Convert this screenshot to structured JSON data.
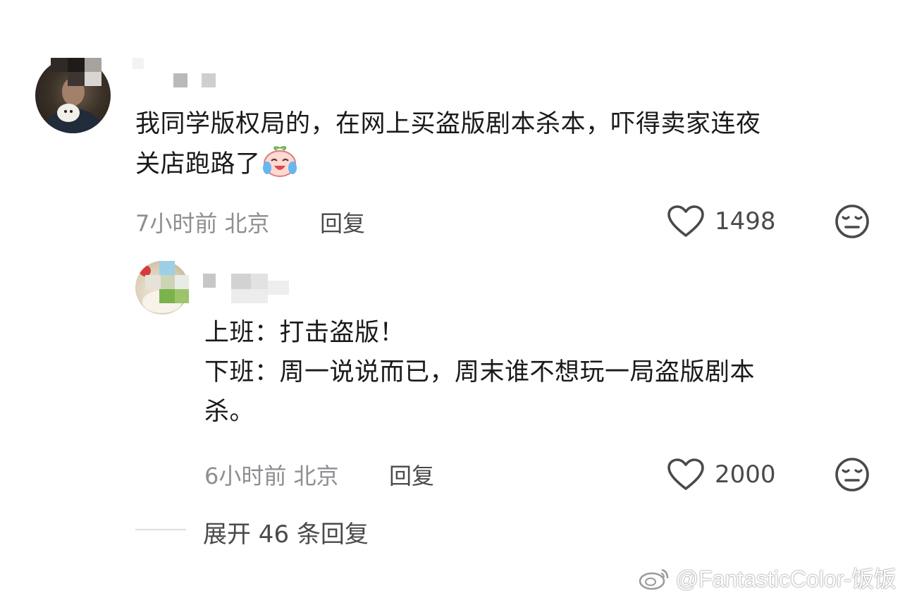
{
  "comments": [
    {
      "text_line1": "我同学版权局的，在网上买盗版剧本杀本，吓得卖家连夜",
      "text_line2": "关店跑路了",
      "emoji": "crying-laughing-emoji",
      "time": "7小时前",
      "location": "北京",
      "reply_label": "回复",
      "likes": "1498"
    },
    {
      "text_line1": "上班：打击盗版！",
      "text_line2": "下班：周一说说而已，周末谁不想玩一局盗版剧本",
      "text_line3": "杀。",
      "time": "6小时前",
      "location": "北京",
      "reply_label": "回复",
      "likes": "2000"
    }
  ],
  "expand_label": "展开 46 条回复",
  "watermark": "@FantasticColor-饭饭",
  "icons": {
    "like": "heart-outline-icon",
    "dislike": "neutral-face-icon",
    "watermark_logo": "weibo-logo"
  }
}
